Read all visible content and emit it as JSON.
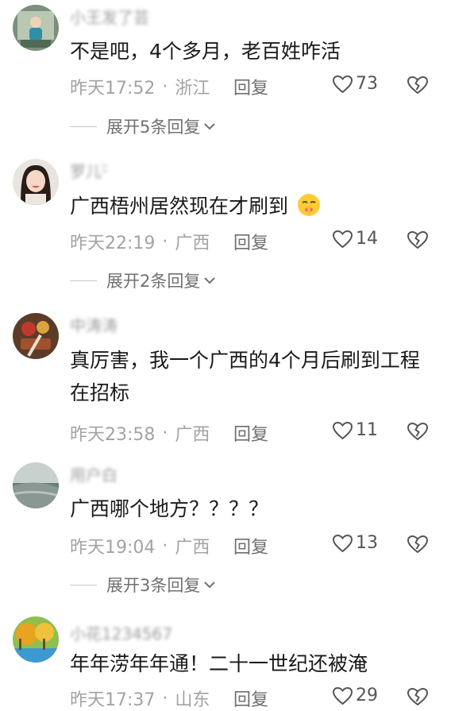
{
  "comments": [
    {
      "username": "小王发了芸",
      "text": "不是吧，4个多月，老百姓咋活",
      "time": "昨天17:52",
      "location": "浙江",
      "reply_label": "回复",
      "likes": "73",
      "expand_label": "展开5条回复"
    },
    {
      "username": "罗儿ᵕ̈",
      "text": "广西梧州居然现在才刷到",
      "time": "昨天22:19",
      "location": "广西",
      "reply_label": "回复",
      "likes": "14",
      "expand_label": "展开2条回复"
    },
    {
      "username": "中涛涛",
      "text": "真厉害，我一个广西的4个月后刷到工程在招标",
      "time": "昨天23:58",
      "location": "广西",
      "reply_label": "回复",
      "likes": "11"
    },
    {
      "username": "用户白",
      "text": "广西哪个地方？？？？",
      "time": "昨天19:04",
      "location": "广西",
      "reply_label": "回复",
      "likes": "13",
      "expand_label": "展开3条回复"
    },
    {
      "username": "小花1234567",
      "text": "年年涝年年通！二十一世纪还被淹",
      "time": "昨天17:37",
      "location": "山东",
      "reply_label": "回复",
      "likes": "29"
    }
  ],
  "colors": {
    "meta_text": "#a3a3a3",
    "divider": "#c8c8c8",
    "primary_text": "#1a1a1a"
  }
}
